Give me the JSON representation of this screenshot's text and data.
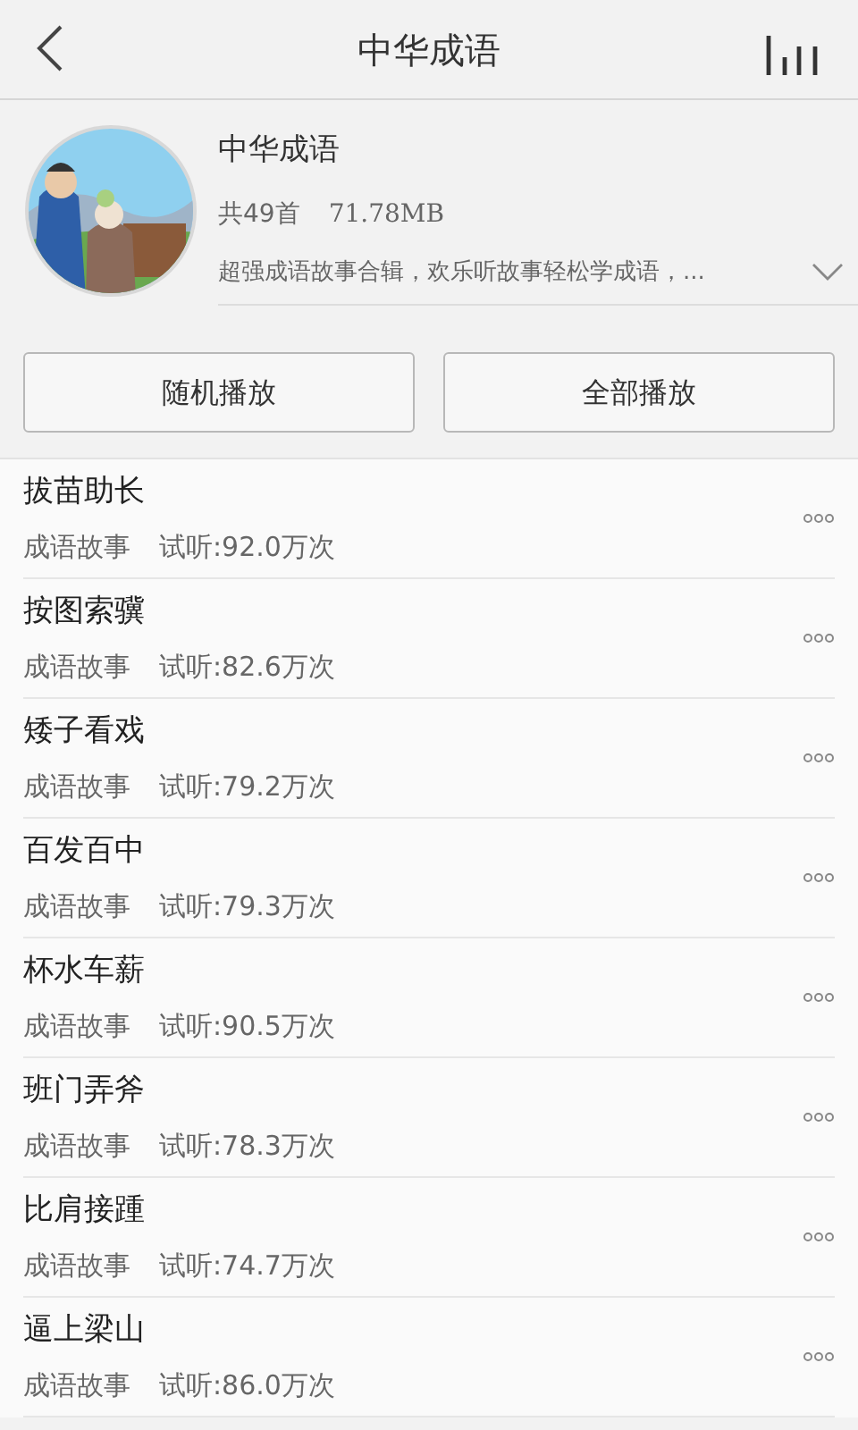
{
  "header": {
    "title": "中华成语"
  },
  "album": {
    "title": "中华成语",
    "count": "共49首",
    "size": "71.78MB",
    "description": "超强成语故事合辑，欢乐听故事轻松学成语，..."
  },
  "buttons": [
    "随机播放",
    "全部播放"
  ],
  "tracks": [
    {
      "title": "拔苗助长",
      "category": "成语故事",
      "plays": "试听:92.0万次"
    },
    {
      "title": "按图索骥",
      "category": "成语故事",
      "plays": "试听:82.6万次"
    },
    {
      "title": "矮子看戏",
      "category": "成语故事",
      "plays": "试听:79.2万次"
    },
    {
      "title": "百发百中",
      "category": "成语故事",
      "plays": "试听:79.3万次"
    },
    {
      "title": "杯水车薪",
      "category": "成语故事",
      "plays": "试听:90.5万次"
    },
    {
      "title": "班门弄斧",
      "category": "成语故事",
      "plays": "试听:78.3万次"
    },
    {
      "title": "比肩接踵",
      "category": "成语故事",
      "plays": "试听:74.7万次"
    },
    {
      "title": "逼上梁山",
      "category": "成语故事",
      "plays": "试听:86.0万次"
    }
  ]
}
